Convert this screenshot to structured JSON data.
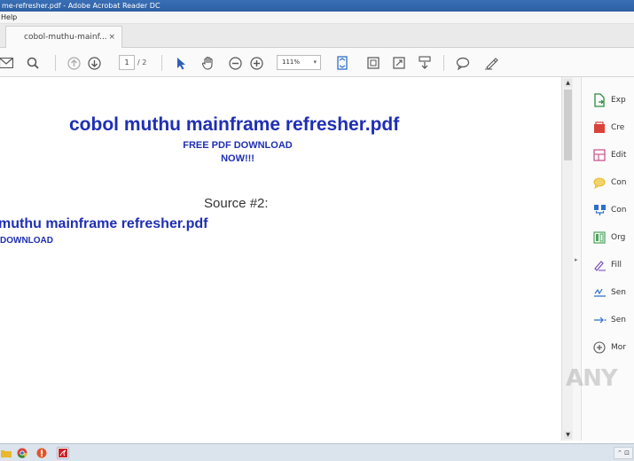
{
  "window": {
    "title": "me-refresher.pdf - Adobe Acrobat Reader DC"
  },
  "menu": {
    "help": "Help"
  },
  "tab": {
    "label": "cobol-muthu-mainf...",
    "close": "×"
  },
  "toolbar": {
    "page_current": "1",
    "page_total": "/ 2",
    "zoom": "111%",
    "zoom_dd": "▾"
  },
  "document": {
    "title": "cobol muthu mainframe refresher.pdf",
    "subtitle_line1": "FREE PDF DOWNLOAD",
    "subtitle_line2": "NOW!!!",
    "source": "Source #2:",
    "title2": "muthu mainframe refresher.pdf",
    "subtitle2": "DOWNLOAD"
  },
  "right_panel": {
    "items": [
      {
        "label": "Exp",
        "icon": "export-pdf-icon",
        "color": "#2e8b3a"
      },
      {
        "label": "Cre",
        "icon": "create-pdf-icon",
        "color": "#d9443a"
      },
      {
        "label": "Edit",
        "icon": "edit-pdf-icon",
        "color": "#c94b8a"
      },
      {
        "label": "Con",
        "icon": "comment-icon",
        "color": "#e8b92a"
      },
      {
        "label": "Con",
        "icon": "combine-files-icon",
        "color": "#2f6fc9"
      },
      {
        "label": "Org",
        "icon": "organize-pages-icon",
        "color": "#4aa55a"
      },
      {
        "label": "Fill",
        "icon": "fill-sign-icon",
        "color": "#7a4fb8"
      },
      {
        "label": "Sen",
        "icon": "send-for-signature-icon",
        "color": "#2f6fc9"
      },
      {
        "label": "Sen",
        "icon": "send-track-icon",
        "color": "#2f6fc9"
      },
      {
        "label": "Mor",
        "icon": "more-tools-icon",
        "color": "#555555"
      }
    ]
  },
  "watermark": "ANY",
  "taskbar": {
    "tray": "⌃ ⊡"
  }
}
